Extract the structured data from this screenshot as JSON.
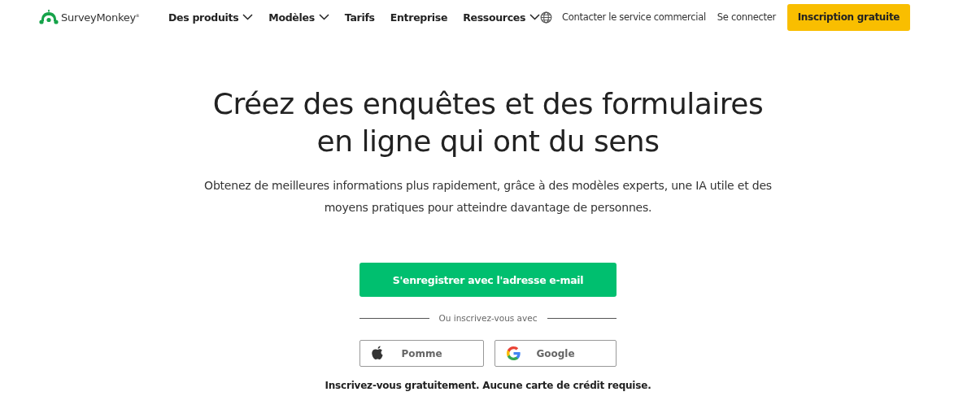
{
  "header": {
    "logo": "SurveyMonkey$^{®}$",
    "nav": [
      {
        "label": "Des produits",
        "has_menu": true
      },
      {
        "label": "Modèles",
        "has_menu": true
      },
      {
        "label": "Tarifs",
        "has_menu": false
      },
      {
        "label": "Entreprise",
        "has_menu": false
      },
      {
        "label": "Ressources",
        "has_menu": true
      }
    ],
    "contact": "Contacter le service commercial",
    "login": "Se connecter",
    "signup": "Inscription gratuite"
  },
  "hero": {
    "title_lines": [
      "Créez des enquêtes et des formulaires",
      "en ligne qui ont du sens"
    ],
    "subtitle": "Obtenez de meilleures informations plus rapidement, grâce à des modèles experts, une IA utile et des moyens pratiques pour atteindre davantage de personnes.",
    "email_button": "S'enregistrer avec l'adresse e-mail",
    "divider": "Ou inscrivez-vous avec",
    "social": [
      {
        "kind": "apple",
        "label": "Pomme"
      },
      {
        "kind": "google",
        "label": "Google"
      }
    ],
    "note": "Inscrivez-vous gratuitement. Aucune carte de crédit requise."
  }
}
